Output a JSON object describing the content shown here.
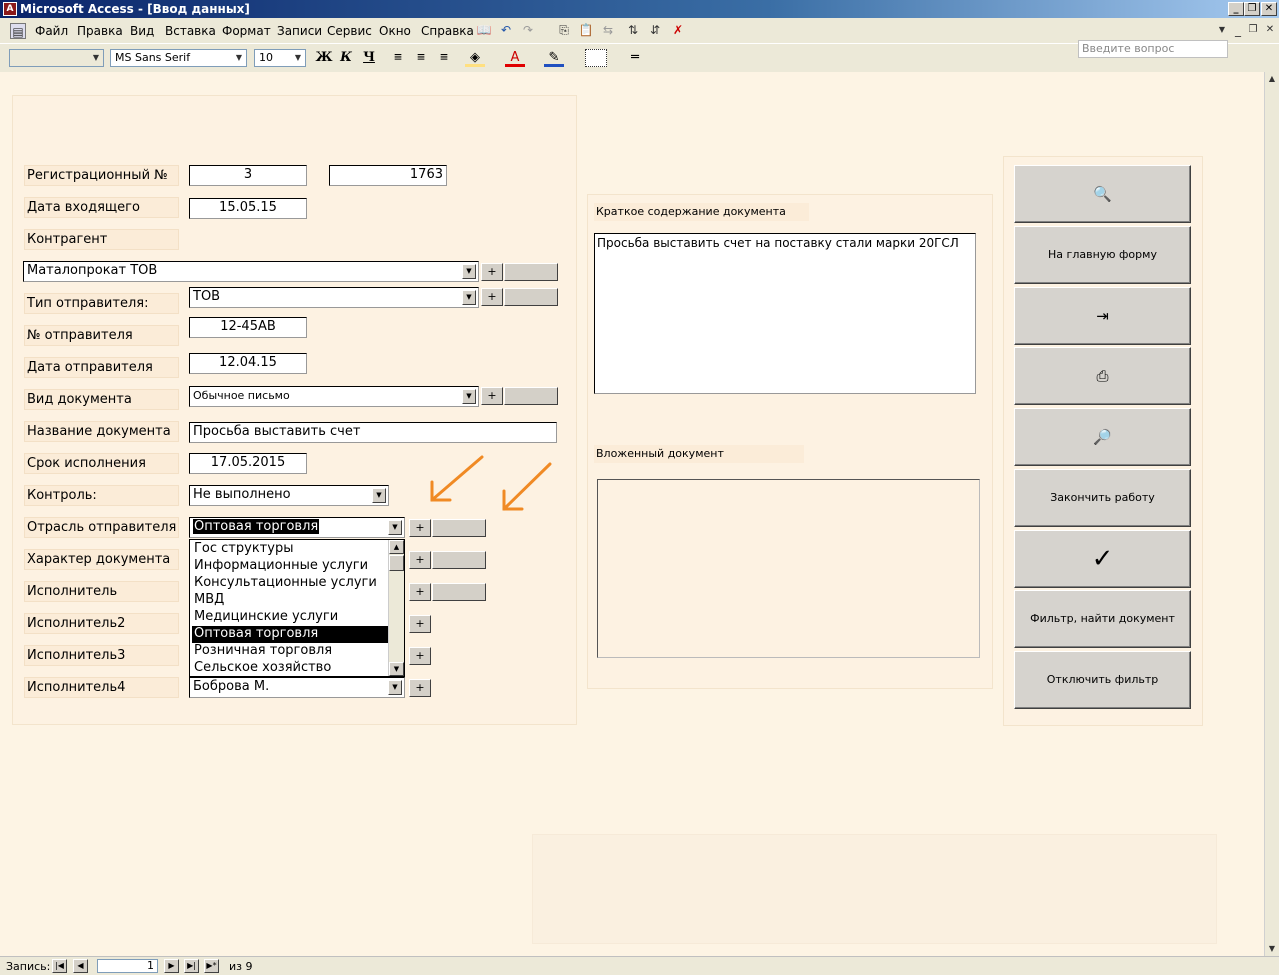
{
  "window": {
    "title": "Microsoft Access - [Ввод данных]"
  },
  "menu": [
    "Файл",
    "Правка",
    "Вид",
    "Вставка",
    "Формат",
    "Записи",
    "Сервис",
    "Окно",
    "Справка"
  ],
  "help_placeholder": "Введите вопрос",
  "format_bar": {
    "object_combo": "",
    "font": "MS Sans Serif",
    "size": "10",
    "bold": "Ж",
    "italic": "К",
    "underline": "Ч",
    "font_color_glyph": "A"
  },
  "form": {
    "reg_label": "Регистрационный №",
    "reg_value": "3",
    "reg_value2": "1763",
    "date_in_label": "Дата  входящего",
    "date_in_value": "15.05.15",
    "counterparty_label": "Контрагент",
    "counterparty_value": "Маталопрокат ТОВ",
    "sender_type_label": "Тип отправителя:",
    "sender_type_value": "ТОВ",
    "sender_no_label": "№ отправителя",
    "sender_no_value": "12-45АВ",
    "sender_date_label": "Дата отправителя",
    "sender_date_value": "12.04.15",
    "doc_kind_label": "Вид документа",
    "doc_kind_value": "Обычное письмо",
    "doc_name_label": "Название документа",
    "doc_name_value": "Просьба  выставить счет",
    "deadline_label": "Срок исполнения",
    "deadline_value": "17.05.2015",
    "control_label": "Контроль:",
    "control_value": "Не выполнено",
    "industry_label": "Отрасль отправителя",
    "industry_value": "Оптовая торговля",
    "doc_character_label": "Характер документа",
    "executor_label": "Исполнитель",
    "executor2_label": "Исполнитель2",
    "executor3_label": "Исполнитель3",
    "executor4_label": "Исполнитель4",
    "executor4_value": "Боброва М.",
    "plus": "+",
    "summary_label": "Краткое содержание документа",
    "summary_value": "Просьба выставить счет на поставку стали марки 20ГСЛ",
    "attached_label": "Вложенный документ"
  },
  "industry_options": [
    "Гос структуры",
    "Информационные услуги",
    "Консультационные услуги",
    "МВД",
    "Медицинские услуги",
    "Оптовая торговля",
    "Розничная торговля",
    "Сельское хозяйство"
  ],
  "industry_selected": "Оптовая торговля",
  "side_buttons": {
    "find_glyph": "🔍",
    "main_form": "На главную форму",
    "exit_glyph": "⇥",
    "print_glyph": "⎙",
    "preview_glyph": "🔎",
    "finish": "Закончить работу",
    "ok_glyph": "✓",
    "filter": "Фильтр, найти документ",
    "filter_off": "Отключить фильтр"
  },
  "status": {
    "record_label": "Запись:",
    "record_value": "1",
    "of_text": "из  9"
  },
  "annotation_color": "#f08a24"
}
